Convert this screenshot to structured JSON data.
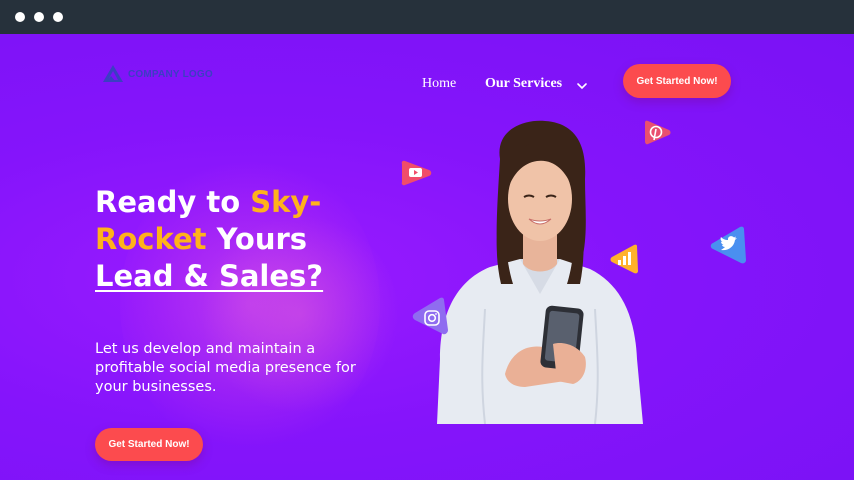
{
  "window": {
    "controls": [
      "close-dot",
      "minimize-dot",
      "maximize-dot"
    ]
  },
  "header": {
    "logo_text": "COMPANY LOGO",
    "nav": [
      {
        "label": "Home"
      },
      {
        "label": "Our Services"
      }
    ],
    "cta_label": "Get Started Now!"
  },
  "hero": {
    "headline": {
      "part1": "Ready to ",
      "accent1": "Sky-",
      "accent2": "Rocket",
      "part2": " Yours",
      "underlined": "Lead & Sales?"
    },
    "subtext": "Let us develop and maintain a profitable social media presence for your businesses.",
    "cta_label": "Get Started Now!"
  },
  "social_icons": [
    "youtube-icon",
    "pinterest-icon",
    "analytics-icon",
    "twitter-icon",
    "instagram-icon"
  ],
  "colors": {
    "background": "#7a12f5",
    "accent": "#ffb21b",
    "cta": "#fc4b4e",
    "titlebar": "#26313b",
    "logo": "#3b3fc2"
  }
}
